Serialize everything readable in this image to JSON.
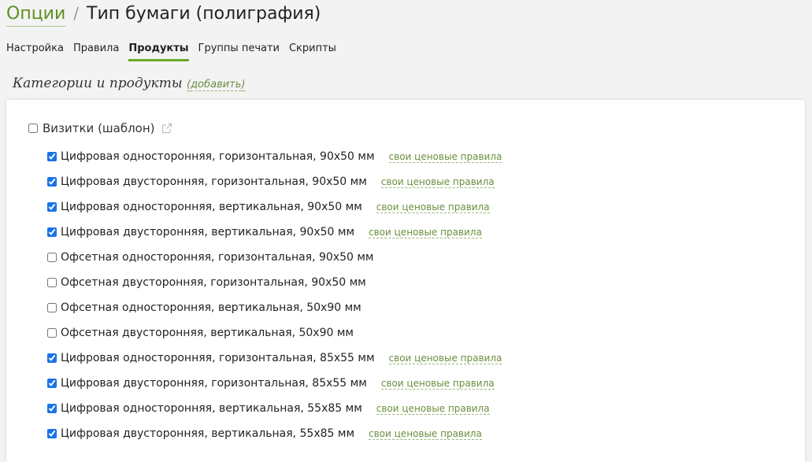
{
  "breadcrumb": {
    "root": "Опции",
    "separator": "/",
    "title": "Тип бумаги (полиграфия)"
  },
  "tabs": [
    {
      "label": "Настройка",
      "active": false
    },
    {
      "label": "Правила",
      "active": false
    },
    {
      "label": "Продукты",
      "active": true
    },
    {
      "label": "Группы печати",
      "active": false
    },
    {
      "label": "Скрипты",
      "active": false
    }
  ],
  "section": {
    "heading": "Категории и продукты",
    "add_link": "добавить",
    "add_open": "(",
    "add_close": ")"
  },
  "category": {
    "label": "Визитки (шаблон)",
    "checked": false,
    "icon": "external-link-icon"
  },
  "products": [
    {
      "label": "Цифровая односторонняя, горизонтальная, 90x50 мм",
      "checked": true,
      "rules_link": "свои ценовые правила"
    },
    {
      "label": "Цифровая двусторонняя, горизонтальная, 90x50 мм",
      "checked": true,
      "rules_link": "свои ценовые правила"
    },
    {
      "label": "Цифровая односторонняя, вертикальная, 90x50 мм",
      "checked": true,
      "rules_link": "свои ценовые правила"
    },
    {
      "label": "Цифровая двусторонняя, вертикальная, 90x50 мм",
      "checked": true,
      "rules_link": "свои ценовые правила"
    },
    {
      "label": "Офсетная односторонняя, горизонтальная, 90x50 мм",
      "checked": false,
      "rules_link": ""
    },
    {
      "label": "Офсетная двусторонняя, горизонтальная, 90x50 мм",
      "checked": false,
      "rules_link": ""
    },
    {
      "label": "Офсетная односторонняя, вертикальная, 50x90 мм",
      "checked": false,
      "rules_link": ""
    },
    {
      "label": "Офсетная двусторонняя, вертикальная, 50x90 мм",
      "checked": false,
      "rules_link": ""
    },
    {
      "label": "Цифровая односторонняя, горизонтальная, 85x55 мм",
      "checked": true,
      "rules_link": "свои ценовые правила"
    },
    {
      "label": "Цифровая двусторонняя, горизонтальная, 85x55 мм",
      "checked": true,
      "rules_link": "свои ценовые правила"
    },
    {
      "label": "Цифровая односторонняя, вертикальная, 55x85 мм",
      "checked": true,
      "rules_link": "свои ценовые правила"
    },
    {
      "label": "Цифровая двусторонняя, вертикальная, 55x85 мм",
      "checked": true,
      "rules_link": "свои ценовые правила"
    }
  ],
  "colors": {
    "accent": "#6aaa2a",
    "link": "#6b8f3e",
    "background": "#f3f3f3"
  }
}
